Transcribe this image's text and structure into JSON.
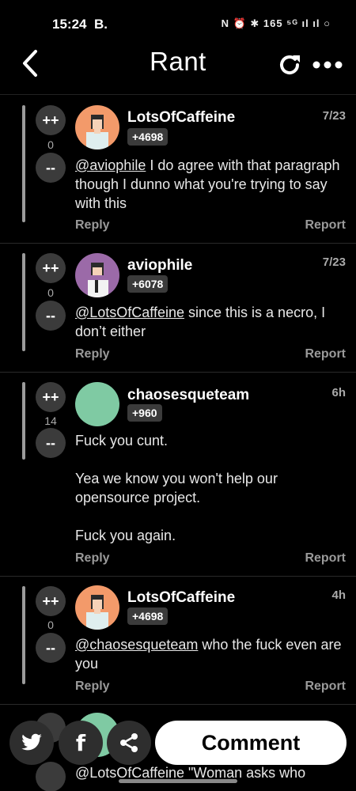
{
  "status_bar": {
    "time": "15:24",
    "carrier_glyph": "B.",
    "icons_text": "N ⏰ ✱ 165 ⁵ᴳ ıl ıl ○"
  },
  "header": {
    "title": "Rant",
    "back_icon": "back-arrow-icon",
    "refresh_icon": "refresh-icon",
    "more_icon": "more-icon"
  },
  "comments": [
    {
      "upvote": "++",
      "downvote": "--",
      "score": "0",
      "username": "LotsOfCaffeine",
      "badge": "+4698",
      "time": "7/23",
      "mention": "@aviophile",
      "text": " I do agree with that paragraph though I dunno what you're trying to say with this",
      "reply": "Reply",
      "report": "Report",
      "avatar_color": "#f39a6a"
    },
    {
      "upvote": "++",
      "downvote": "--",
      "score": "0",
      "username": "aviophile",
      "badge": "+6078",
      "time": "7/23",
      "mention": "@LotsOfCaffeine",
      "text": " since this is a necro, I don’t either",
      "reply": "Reply",
      "report": "Report",
      "avatar_color": "#9b6aa8"
    },
    {
      "upvote": "++",
      "downvote": "--",
      "score": "14",
      "username": "chaosesqueteam",
      "badge": "+960",
      "time": "6h",
      "mention": "",
      "text": "Fuck you cunt.\n\nYea we know you won't help our opensource project.\n\nFuck you again.",
      "reply": "Reply",
      "report": "Report",
      "avatar_color": "#7fcaa3"
    },
    {
      "upvote": "++",
      "downvote": "--",
      "score": "0",
      "username": "LotsOfCaffeine",
      "badge": "+4698",
      "time": "4h",
      "mention": "@chaosesqueteam",
      "text": " who the fuck even are you",
      "reply": "Reply",
      "report": "Report",
      "avatar_color": "#f39a6a"
    }
  ],
  "partial_comment": {
    "text": "@LotsOfCaffeine \"Woman asks who"
  },
  "bottom_bar": {
    "twitter_icon": "twitter-icon",
    "facebook_icon": "facebook-icon",
    "share_icon": "share-icon",
    "facebook_glyph": "f",
    "comment_label": "Comment"
  },
  "colors": {
    "background": "#000000",
    "vote_button": "#3b3b3b",
    "muted_text": "#9a9a9a",
    "badge": "#3b3b3b"
  }
}
